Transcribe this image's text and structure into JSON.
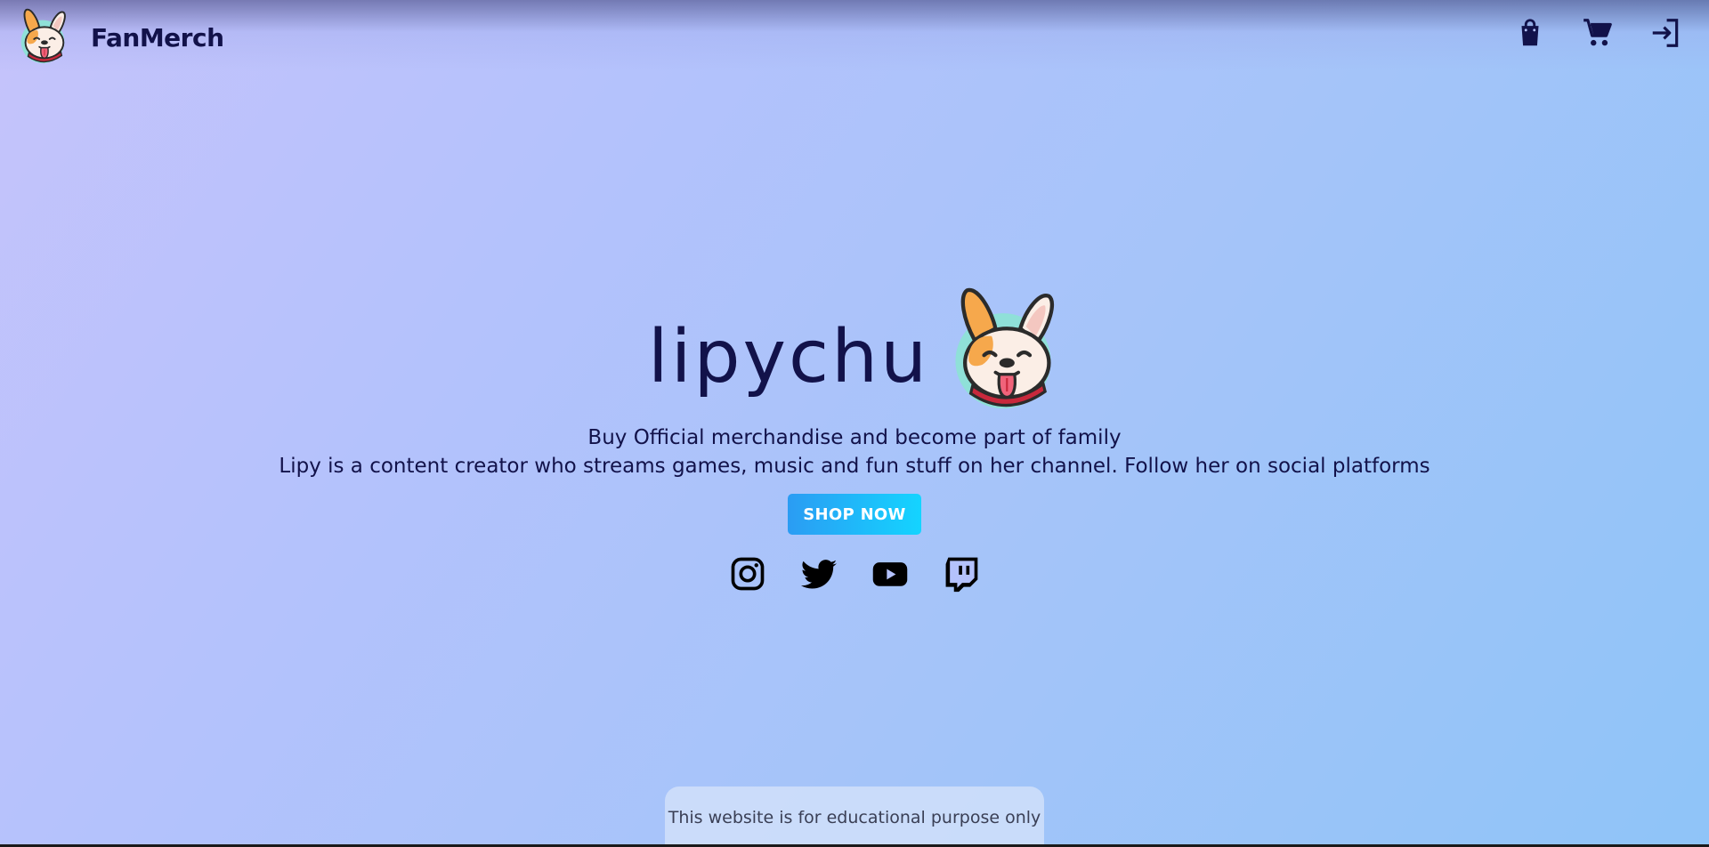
{
  "header": {
    "brand_name": "FanMerch",
    "icons": [
      "shopping-bag-icon",
      "cart-icon",
      "login-icon"
    ]
  },
  "hero": {
    "title": "lipychu",
    "tagline": "Buy Official merchandise and become part of family",
    "description": "Lipy is a content creator who streams games, music and fun stuff on her channel. Follow her on social platforms",
    "cta_label": "SHOP NOW"
  },
  "socials": [
    "instagram-icon",
    "twitter-icon",
    "youtube-icon",
    "twitch-icon"
  ],
  "footer": {
    "note": "This website is for educational purpose only"
  },
  "colors": {
    "text_primary": "#12124a",
    "button_gradient_start": "#2b9cf3",
    "button_gradient_end": "#14d4ff",
    "dog_ear_orange": "#f6a84c",
    "collar_red": "#c8283c",
    "badge_teal": "#8fe0d8"
  }
}
